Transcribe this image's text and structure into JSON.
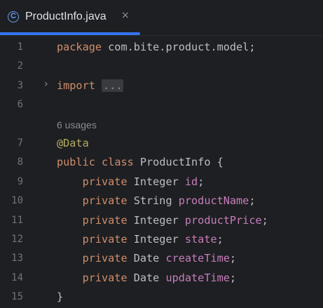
{
  "tab": {
    "icon_letter": "C",
    "title": "ProductInfo.java",
    "close_glyph": "×"
  },
  "editor": {
    "lines": [
      {
        "number": "1",
        "tokens": [
          {
            "kw": "package"
          },
          {
            "plain": " com.bite.product.model;"
          }
        ]
      },
      {
        "number": "2",
        "tokens": []
      },
      {
        "number": "3",
        "fold": "›",
        "tokens": [
          {
            "kw": "import"
          },
          {
            "plain": " "
          },
          {
            "folded": "..."
          }
        ]
      },
      {
        "number": "6",
        "tokens": []
      },
      {
        "hint": "6 usages"
      },
      {
        "number": "7",
        "tokens": [
          {
            "ann": "@Data"
          }
        ]
      },
      {
        "number": "8",
        "tokens": [
          {
            "kw": "public"
          },
          {
            "plain": " "
          },
          {
            "kw": "class"
          },
          {
            "plain": " ProductInfo {"
          }
        ]
      },
      {
        "number": "9",
        "tokens": [
          {
            "plain": "    "
          },
          {
            "kw": "private"
          },
          {
            "plain": " Integer "
          },
          {
            "fld": "id"
          },
          {
            "plain": ";"
          }
        ]
      },
      {
        "number": "10",
        "tokens": [
          {
            "plain": "    "
          },
          {
            "kw": "private"
          },
          {
            "plain": " String "
          },
          {
            "fld": "productName"
          },
          {
            "plain": ";"
          }
        ]
      },
      {
        "number": "11",
        "tokens": [
          {
            "plain": "    "
          },
          {
            "kw": "private"
          },
          {
            "plain": " Integer "
          },
          {
            "fld": "productPrice"
          },
          {
            "plain": ";"
          }
        ]
      },
      {
        "number": "12",
        "tokens": [
          {
            "plain": "    "
          },
          {
            "kw": "private"
          },
          {
            "plain": " Integer "
          },
          {
            "fld": "state"
          },
          {
            "plain": ";"
          }
        ]
      },
      {
        "number": "13",
        "tokens": [
          {
            "plain": "    "
          },
          {
            "kw": "private"
          },
          {
            "plain": " Date "
          },
          {
            "fld": "createTime"
          },
          {
            "plain": ";"
          }
        ]
      },
      {
        "number": "14",
        "tokens": [
          {
            "plain": "    "
          },
          {
            "kw": "private"
          },
          {
            "plain": " Date "
          },
          {
            "fld": "updateTime"
          },
          {
            "plain": ";"
          }
        ]
      },
      {
        "number": "15",
        "tokens": [
          {
            "plain": "}"
          }
        ]
      }
    ]
  },
  "colors": {
    "background": "#1e1f22",
    "keyword": "#cf8e6d",
    "annotation": "#b3ae60",
    "field": "#c77dbb",
    "text": "#bcbec4",
    "tab_accent": "#3574f0"
  }
}
